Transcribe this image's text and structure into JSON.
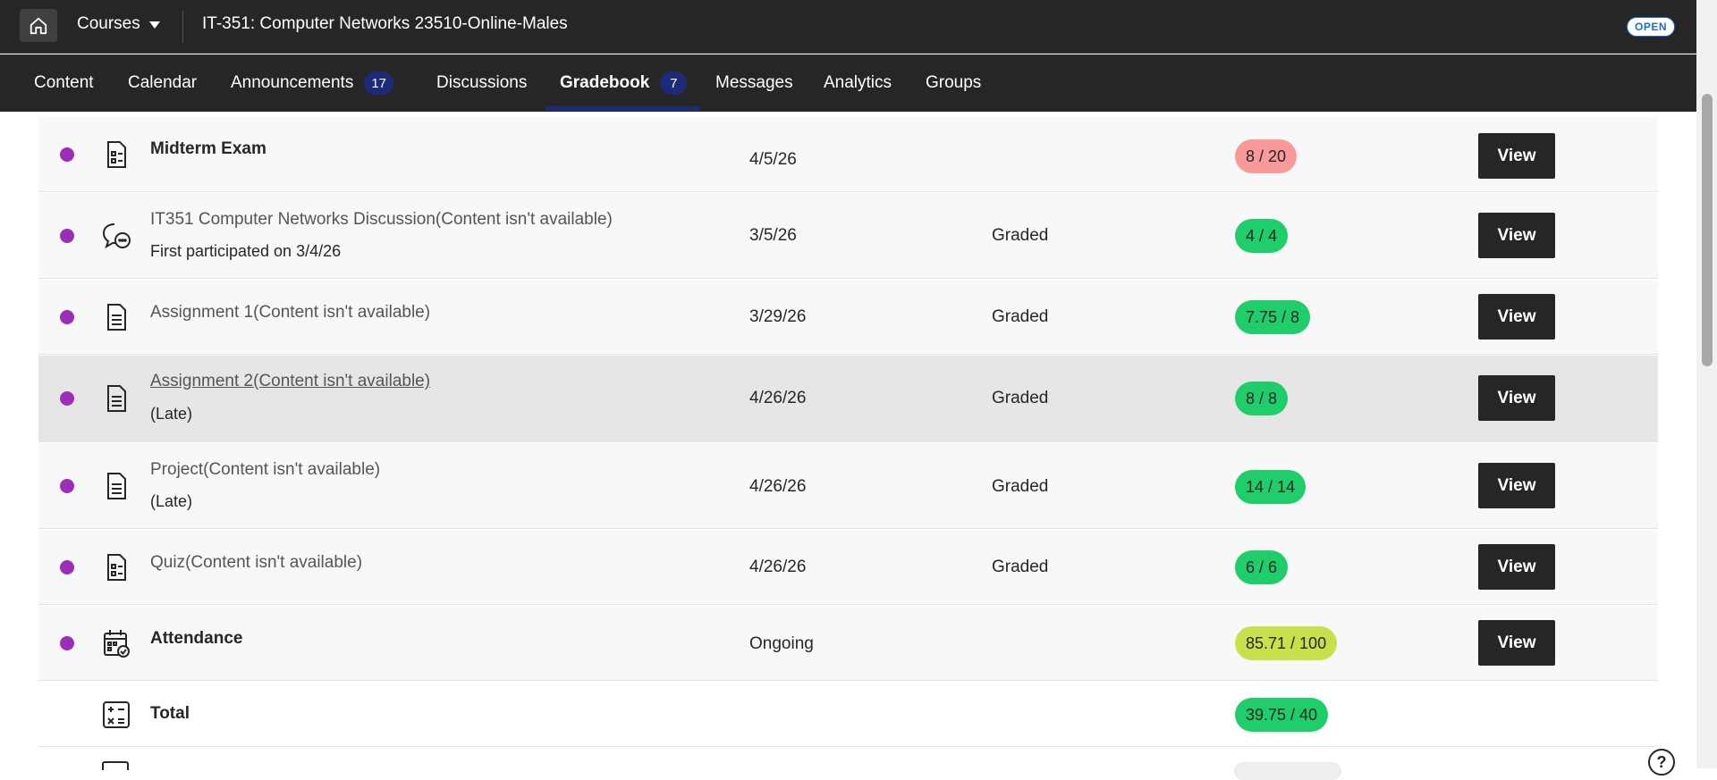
{
  "topbar": {
    "home_icon": "home-icon",
    "courses_label": "Courses",
    "course_title": "IT-351: Computer Networks 23510-Online-Males",
    "status_badge": "OPEN"
  },
  "nav": {
    "tabs": [
      {
        "label": "Content"
      },
      {
        "label": "Calendar"
      },
      {
        "label": "Announcements",
        "count": "17"
      },
      {
        "label": "Discussions"
      },
      {
        "label": "Gradebook",
        "count": "7",
        "active": true
      },
      {
        "label": "Messages"
      },
      {
        "label": "Analytics"
      },
      {
        "label": "Groups"
      }
    ]
  },
  "colors": {
    "dark": "#262626",
    "unread_dot": "#9c2fb8",
    "grade_red": "#f89a9a",
    "grade_green": "#1fce6b",
    "grade_yellow": "#c6e14b",
    "badge_navy": "#1c2a78"
  },
  "gradebook": {
    "rows": [
      {
        "icon": "test-icon",
        "name": "Midterm Exam",
        "sub": "",
        "date": "4/5/26",
        "status": "",
        "grade": "8 / 20",
        "grade_color": "red",
        "button": "View"
      },
      {
        "icon": "discussion-icon",
        "name": "IT351 Computer Networks Discussion(Content isn't available)",
        "sub": "First participated on 3/4/26",
        "date": "3/5/26",
        "status": "Graded",
        "grade": "4 / 4",
        "grade_color": "green",
        "button": "View"
      },
      {
        "icon": "document-icon",
        "name": "Assignment 1(Content isn't available)",
        "sub": "",
        "date": "3/29/26",
        "status": "Graded",
        "grade": "7.75 / 8",
        "grade_color": "green",
        "button": "View"
      },
      {
        "icon": "document-icon",
        "name": "Assignment 2(Content isn't available)",
        "sub": "(Late)",
        "date": "4/26/26",
        "status": "Graded",
        "grade": "8 / 8",
        "grade_color": "green",
        "button": "View"
      },
      {
        "icon": "document-icon",
        "name": "Project(Content isn't available)",
        "sub": "(Late)",
        "date": "4/26/26",
        "status": "Graded",
        "grade": "14 / 14",
        "grade_color": "green",
        "button": "View"
      },
      {
        "icon": "test-icon",
        "name": "Quiz(Content isn't available)",
        "sub": "",
        "date": "4/26/26",
        "status": "Graded",
        "grade": "6 / 6",
        "grade_color": "green",
        "button": "View"
      },
      {
        "icon": "attendance-icon",
        "name": "Attendance",
        "sub": "",
        "date": "Ongoing",
        "status": "",
        "grade": "85.71 / 100",
        "grade_color": "yellow",
        "button": "View"
      },
      {
        "icon": "calculator-icon",
        "name": "Total",
        "sub": "",
        "date": "",
        "status": "",
        "grade": "39.75 / 40",
        "grade_color": "green",
        "button": ""
      }
    ]
  },
  "help_icon": "help-icon",
  "help_label": "?"
}
